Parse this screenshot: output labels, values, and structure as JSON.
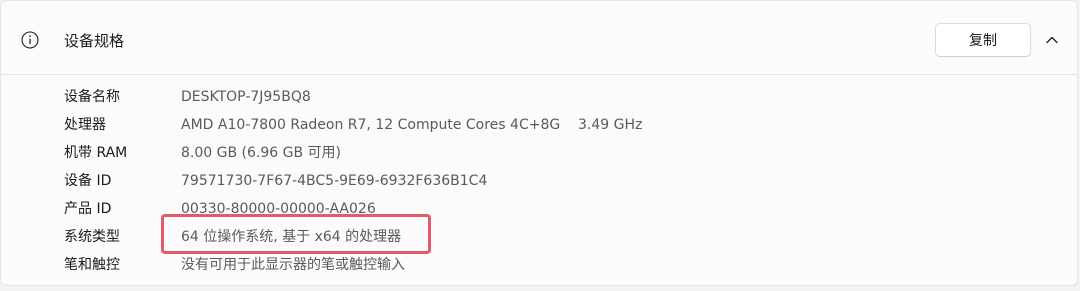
{
  "section": {
    "title": "设备规格",
    "copy_label": "复制",
    "info_icon": "info-icon",
    "collapse_icon": "chevron-up-icon"
  },
  "specs": [
    {
      "label": "设备名称",
      "value": "DESKTOP-7J95BQ8"
    },
    {
      "label": "处理器",
      "value": "AMD A10-7800 Radeon R7, 12 Compute Cores 4C+8G    3.49 GHz"
    },
    {
      "label": "机带 RAM",
      "value": "8.00 GB (6.96 GB 可用)"
    },
    {
      "label": "设备 ID",
      "value": "79571730-7F67-4BC5-9E69-6932F636B1C4"
    },
    {
      "label": "产品 ID",
      "value": "00330-80000-00000-AA026"
    },
    {
      "label": "系统类型",
      "value": "64 位操作系统, 基于 x64 的处理器"
    },
    {
      "label": "笔和触控",
      "value": "没有可用于此显示器的笔或触控输入"
    }
  ],
  "colors": {
    "highlight_border": "#e15b6b",
    "card_background": "#fbfbfb"
  }
}
